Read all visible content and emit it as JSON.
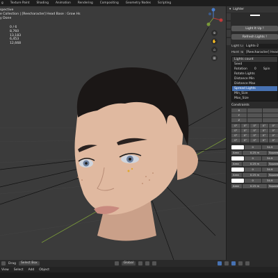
{
  "topbar": {
    "tabs": [
      "g",
      "Texture Paint",
      "Shading",
      "Animation",
      "Rendering",
      "Compositing",
      "Geometry Nodes",
      "Scripting"
    ]
  },
  "viewport": {
    "view_label": "spective",
    "collection_label": "e Collection | [Reecharacter] Head Base : Grow Hs",
    "status_label": "y Done",
    "stats": [
      {
        "label": "",
        "value": "0 / 6"
      },
      {
        "label": "",
        "value": "8,760"
      },
      {
        "label": "",
        "value": "13,183"
      },
      {
        "label": "",
        "value": "6,453"
      },
      {
        "label": "",
        "value": "12,668"
      }
    ]
  },
  "npanel": {
    "header_title": "Lighter",
    "light_it_up": "Light It Up !",
    "refresh_lights": "Refresh Lights !",
    "light_collection_label": "Light Coll...",
    "light_collection_value": "Lights-2",
    "point_to_label": "Point To",
    "point_to_value": "[Reecharacter] Head Base",
    "lights_count": "Lights count",
    "options": [
      {
        "label": "Seed",
        "value": ""
      },
      {
        "label": "Rotation",
        "value": "0",
        "extra": "Spin"
      },
      {
        "label": "Rotate Lights",
        "value": ""
      },
      {
        "label": "Distance Min",
        "value": ""
      },
      {
        "label": "Distance Max",
        "value": ""
      },
      {
        "label": "Spread Lights",
        "value": "",
        "selected": true
      },
      {
        "label": "Min_Size",
        "value": ""
      },
      {
        "label": "Max_Size",
        "value": ""
      }
    ],
    "constraints_label": "Constraints",
    "xyz_rows": [
      [
        "X",
        "",
        ""
      ],
      [
        "Y",
        "",
        ""
      ],
      [
        "Z",
        "",
        ""
      ]
    ],
    "angle_rows": [
      [
        "0°",
        "0°",
        "0°",
        "0°",
        "0°"
      ],
      [
        "0°",
        "0°",
        "0°",
        "0°",
        "0°"
      ],
      [
        "0°",
        "0°",
        "0°",
        "0°",
        "0°"
      ],
      [
        "0°",
        "0°",
        "0°",
        "0°",
        "0°"
      ]
    ],
    "lamps": [
      {
        "value": "0",
        "power": "34.9",
        "type": "Area",
        "size": "0.25 m",
        "shape": "Square"
      },
      {
        "value": "0",
        "power": "34.9",
        "type": "Area",
        "size": "0.25 m",
        "shape": "Square"
      },
      {
        "value": "0",
        "power": "34.9",
        "type": "Area",
        "size": "0.25 m",
        "shape": "Square"
      },
      {
        "value": "0",
        "power": "34.9",
        "type": "Area",
        "size": "0.25 m",
        "shape": "Square"
      }
    ]
  },
  "bottombar": {
    "drag_label": "Drag",
    "select_box": "Select Box",
    "transform": "Global",
    "menus": [
      "View",
      "Select",
      "Add",
      "Object"
    ]
  }
}
